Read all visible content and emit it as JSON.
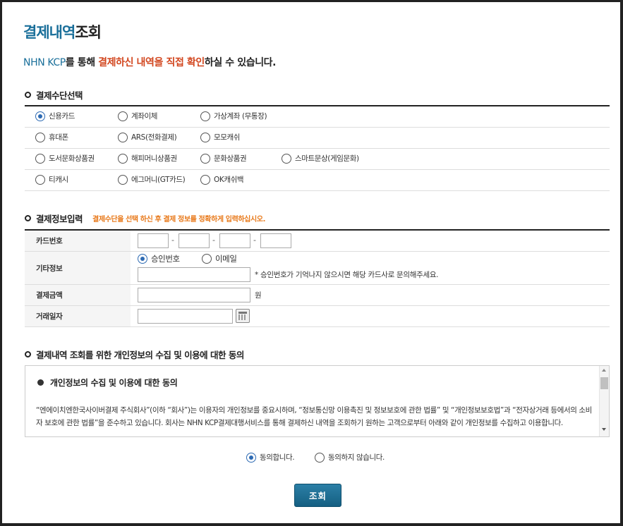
{
  "title": {
    "part1": "결제내역",
    "part2": "조회"
  },
  "intro": {
    "brand": "NHN KCP",
    "text1": "를 통해 ",
    "highlight": "결제하신 내역을 직접 확인",
    "text2": "하실 수 있습니다."
  },
  "payment_method": {
    "heading": "결제수단선택",
    "options": [
      {
        "label": "신용카드",
        "selected": true
      },
      {
        "label": "계좌이체",
        "selected": false
      },
      {
        "label": "가상계좌 (무통장)",
        "selected": false
      },
      {
        "label": "휴대폰",
        "selected": false
      },
      {
        "label": "ARS(전화결제)",
        "selected": false
      },
      {
        "label": "모모캐쉬",
        "selected": false
      },
      {
        "label": "도서문화상품권",
        "selected": false
      },
      {
        "label": "해피머니상품권",
        "selected": false
      },
      {
        "label": "문화상품권",
        "selected": false
      },
      {
        "label": "스마트문상(게임문화)",
        "selected": false
      },
      {
        "label": "티캐시",
        "selected": false
      },
      {
        "label": "에그머니(GT카드)",
        "selected": false
      },
      {
        "label": "OK캐쉬백",
        "selected": false
      }
    ]
  },
  "payment_info": {
    "heading": "결제정보입력",
    "note": "결제수단을 선택 하신 후 결제 정보를 정확하게 입력하십시오.",
    "card_number_label": "카드번호",
    "card_separator": "-",
    "etc_label": "기타정보",
    "approval_option": "승인번호",
    "email_option": "이메일",
    "etc_hint": "* 승인번호가 기억나지 않으시면 해당 카드사로 문의해주세요.",
    "amount_label": "결제금액",
    "amount_unit": "원",
    "date_label": "거래일자"
  },
  "consent": {
    "heading": "결제내역 조회를 위한 개인정보의 수집 및 이용에 대한 동의",
    "box_title": "개인정보의 수집 및 이용에 대한 동의",
    "box_text": "“엔에이치엔한국사이버결제 주식회사”(이하 “회사”)는 이용자의 개인정보를 중요시하며, “정보통신망 이용촉진 및 정보보호에 관한 법률” 및 “개인정보보호법”과 “전자상거래 등에서의 소비자 보호에 관한 법률”을 준수하고 있습니다. 회사는 NHN KCP결제대행서비스를 통해 결제하신 내역을 조회하기 원하는 고객으로부터 아래와 같이 개인정보를 수집하고 이용합니다.",
    "agree_label": "동의합니다.",
    "disagree_label": "동의하지 않습니다."
  },
  "submit_label": "조회",
  "colors": {
    "accent": "#1a6f9a",
    "highlight": "#d2461e",
    "note": "#e8791a",
    "button": "#1c6a90"
  }
}
